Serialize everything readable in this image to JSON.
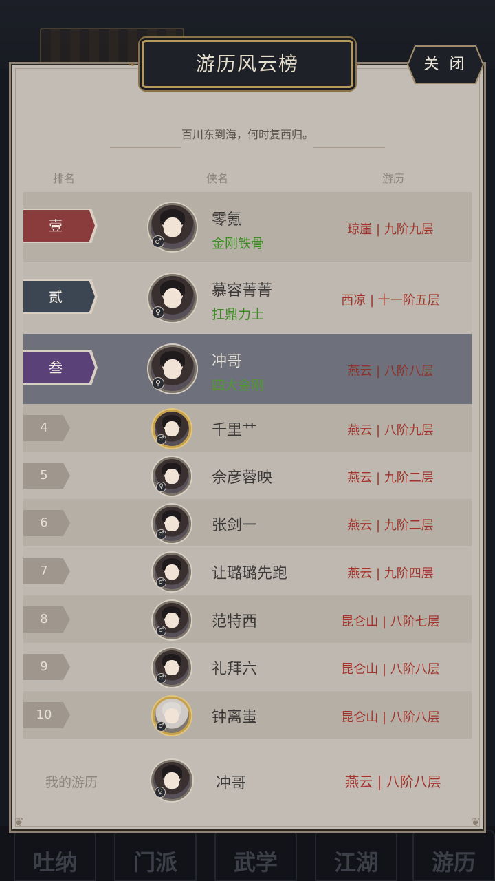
{
  "background": {
    "nav_labels": [
      "吐纳",
      "门派",
      "武学",
      "江湖",
      "游历"
    ]
  },
  "panel": {
    "title": "游历风云榜",
    "close_label": "关 闭",
    "subtitle": "百川东到海，何时复西归。",
    "headers": {
      "rank": "排名",
      "name": "侠名",
      "progress": "游历"
    }
  },
  "colors": {
    "rank1": "#8a3b3b",
    "rank2": "#3b4652",
    "rank3": "#5a4177",
    "progress_text": "#a2342c",
    "title_tag": "#3d8a24",
    "highlight_row": "#6e707c"
  },
  "rows": [
    {
      "rank": "壹",
      "name": "零氪",
      "tag": "金刚铁骨",
      "progress": "琼崖 | 九阶九层",
      "avatar": "avatar-masked-female"
    },
    {
      "rank": "贰",
      "name": "慕容菁菁",
      "tag": "扛鼎力士",
      "progress": "西凉 | 十一阶五层",
      "avatar": "avatar-female"
    },
    {
      "rank": "叁",
      "name": "冲哥",
      "tag": "四大金刚",
      "progress": "燕云 | 八阶八层",
      "avatar": "avatar-female"
    },
    {
      "rank": "4",
      "name": "千里艹",
      "progress": "燕云 | 八阶九层",
      "avatar": "avatar-male-gold"
    },
    {
      "rank": "5",
      "name": "佘彦蓉映",
      "progress": "燕云 | 九阶二层",
      "avatar": "avatar-female-white"
    },
    {
      "rank": "6",
      "name": "张剑一",
      "progress": "燕云 | 九阶二层",
      "avatar": "avatar-male"
    },
    {
      "rank": "7",
      "name": "让璐璐先跑",
      "progress": "燕云 | 九阶四层",
      "avatar": "avatar-male"
    },
    {
      "rank": "8",
      "name": "范特西",
      "progress": "昆仑山 | 八阶七层",
      "avatar": "avatar-male"
    },
    {
      "rank": "9",
      "name": "礼拜六",
      "progress": "昆仑山 | 八阶八层",
      "avatar": "avatar-male"
    },
    {
      "rank": "10",
      "name": "钟离蚩",
      "progress": "昆仑山 | 八阶八层",
      "avatar": "avatar-elder"
    }
  ],
  "mine": {
    "label": "我的游历",
    "name": "冲哥",
    "progress": "燕云 | 八阶八层"
  }
}
